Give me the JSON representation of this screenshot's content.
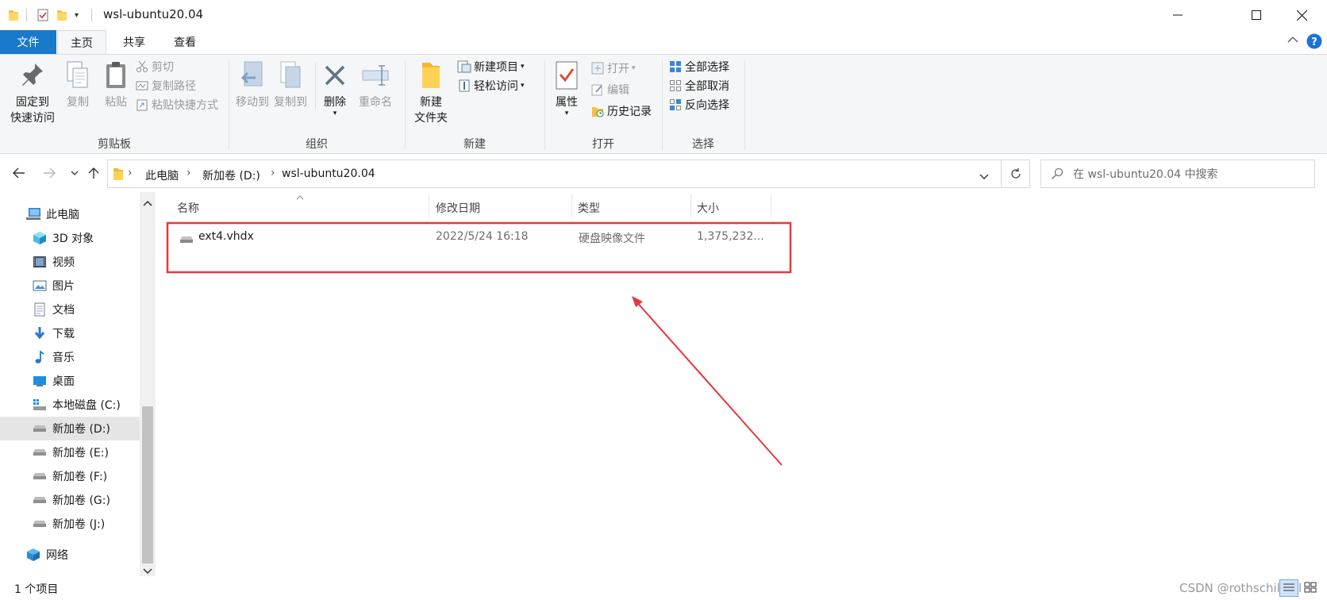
{
  "window": {
    "title": "wsl-ubuntu20.04",
    "controls": {
      "minimize": "─",
      "maximize": "☐",
      "close": "✕"
    }
  },
  "tabs": [
    {
      "label": "文件"
    },
    {
      "label": "主页"
    },
    {
      "label": "共享"
    },
    {
      "label": "查看"
    }
  ],
  "ribbon": {
    "clipboard": {
      "pin_line1": "固定到",
      "pin_line2": "快速访问",
      "copy": "复制",
      "paste": "粘贴",
      "cut": "剪切",
      "copy_path": "复制路径",
      "paste_shortcut": "粘贴快捷方式",
      "group": "剪贴板"
    },
    "organize": {
      "move_to": "移动到",
      "copy_to": "复制到",
      "delete": "删除",
      "rename": "重命名",
      "group": "组织"
    },
    "new": {
      "new_folder_line1": "新建",
      "new_folder_line2": "文件夹",
      "new_item": "新建项目",
      "easy_access": "轻松访问",
      "group": "新建"
    },
    "open": {
      "properties": "属性",
      "open": "打开",
      "edit": "编辑",
      "history": "历史记录",
      "group": "打开"
    },
    "select": {
      "select_all": "全部选择",
      "select_none": "全部取消",
      "invert": "反向选择",
      "group": "选择"
    }
  },
  "address": {
    "crumbs": [
      "此电脑",
      "新加卷 (D:)",
      "wsl-ubuntu20.04"
    ],
    "search_placeholder": "在 wsl-ubuntu20.04 中搜索"
  },
  "nav": {
    "items": [
      {
        "label": "此电脑",
        "icon": "computer-icon"
      },
      {
        "label": "3D 对象",
        "icon": "cube-icon"
      },
      {
        "label": "视频",
        "icon": "video-icon"
      },
      {
        "label": "图片",
        "icon": "picture-icon"
      },
      {
        "label": "文档",
        "icon": "document-icon"
      },
      {
        "label": "下载",
        "icon": "download-icon"
      },
      {
        "label": "音乐",
        "icon": "music-icon"
      },
      {
        "label": "桌面",
        "icon": "desktop-icon"
      },
      {
        "label": "本地磁盘 (C:)",
        "icon": "windows-drive-icon"
      },
      {
        "label": "新加卷 (D:)",
        "icon": "drive-icon"
      },
      {
        "label": "新加卷 (E:)",
        "icon": "drive-icon"
      },
      {
        "label": "新加卷 (F:)",
        "icon": "drive-icon"
      },
      {
        "label": "新加卷 (G:)",
        "icon": "drive-icon"
      },
      {
        "label": "新加卷 (J:)",
        "icon": "drive-icon"
      },
      {
        "label": "网络",
        "icon": "network-icon"
      }
    ],
    "selected_index": 9
  },
  "list": {
    "columns": [
      "名称",
      "修改日期",
      "类型",
      "大小"
    ],
    "rows": [
      {
        "name": "ext4.vhdx",
        "modified": "2022/5/24 16:18",
        "type": "硬盘映像文件",
        "size": "1,375,232..."
      }
    ]
  },
  "status": {
    "count": "1 个项目"
  },
  "watermark": "CSDN @rothschildlhl",
  "colors": {
    "accent": "#1979ca",
    "annotation": "#e8383d",
    "selected_nav": "#e5e5e5"
  }
}
